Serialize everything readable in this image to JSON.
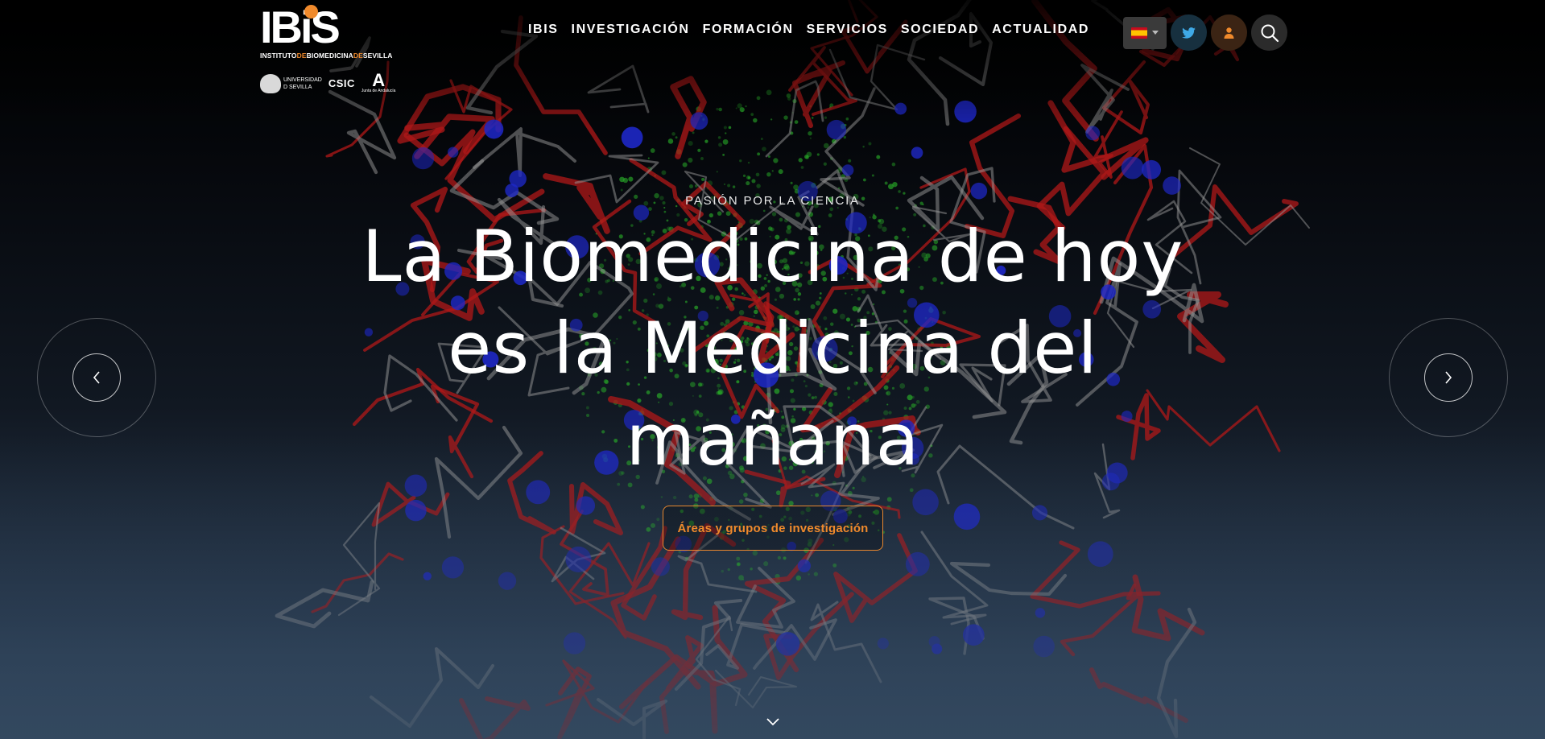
{
  "brand": {
    "logo_word": "IBiS",
    "logo_sub_parts": [
      "INSTITUTO",
      "DE",
      "BIOMEDICINA",
      "DE",
      "SEVILLA"
    ],
    "partners": {
      "us_line1": "UNIVERSIDAD",
      "us_line2": "D SEVILLA",
      "csic": "CSIC",
      "junta_mark": "A",
      "junta_text": "Junta de Andalucía"
    },
    "accent_color": "#f08a2c"
  },
  "nav": {
    "items": [
      "IBIS",
      "INVESTIGACIÓN",
      "FORMACIÓN",
      "SERVICIOS",
      "SOCIEDAD",
      "ACTUALIDAD"
    ]
  },
  "tools": {
    "language_flag": "spain-flag-icon",
    "twitter_icon": "twitter-icon",
    "user_icon": "user-icon",
    "search_icon": "search-icon"
  },
  "hero": {
    "kicker": "PASIÓN POR LA CIENCIA",
    "headline": "La Biomedicina de hoy es la Medicina del mañana",
    "cta_label": "Áreas y grupos de investigación"
  },
  "carousel": {
    "prev_icon": "chevron-left-icon",
    "next_icon": "chevron-right-icon"
  },
  "scroll_icon": "chevron-down-icon"
}
